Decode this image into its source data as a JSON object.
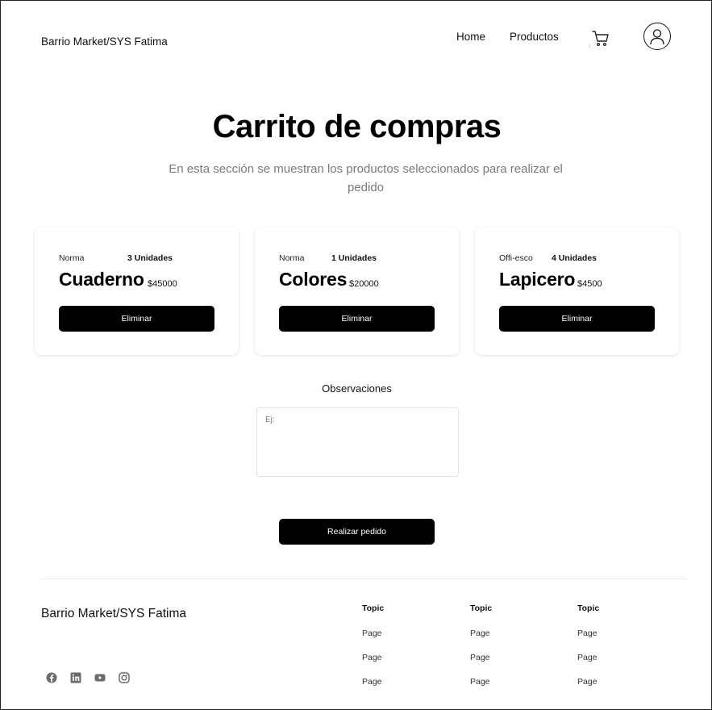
{
  "header": {
    "brand": "Barrio Market/SYS Fatima",
    "nav": [
      {
        "label": "Home"
      },
      {
        "label": "Productos"
      }
    ],
    "icons": {
      "cart": "cart-icon",
      "profile": "user-avatar-icon"
    }
  },
  "hero": {
    "title": "Carrito de compras",
    "subtitle": "En esta sección se muestran los productos seleccionados para realizar el pedido"
  },
  "cart_items": [
    {
      "brand": "Norma",
      "units": "3 Unidades",
      "name": "Cuaderno",
      "price": "$45000",
      "delete_label": "Eliminar"
    },
    {
      "brand": "Norma",
      "units": "1 Unidades",
      "name": "Colores",
      "price": "$20000",
      "delete_label": "Eliminar"
    },
    {
      "brand": "Offi-esco",
      "units": "4 Unidades",
      "name": "Lapicero",
      "price": "$4500",
      "delete_label": "Eliminar"
    }
  ],
  "observations": {
    "label": "Observaciones",
    "placeholder": "Ej:",
    "value": ""
  },
  "submit_label": "Realizar pedido",
  "footer": {
    "brand": "Barrio Market/SYS Fatima",
    "social_icons": [
      "facebook-icon",
      "linkedin-icon",
      "youtube-icon",
      "instagram-icon"
    ],
    "columns": [
      {
        "topic": "Topic",
        "pages": [
          "Page",
          "Page",
          "Page"
        ]
      },
      {
        "topic": "Topic",
        "pages": [
          "Page",
          "Page",
          "Page"
        ]
      },
      {
        "topic": "Topic",
        "pages": [
          "Page",
          "Page",
          "Page"
        ]
      }
    ]
  },
  "colors": {
    "accent": "#000000",
    "subtitle_text": "#7a7a7a",
    "background": "#ffffff"
  }
}
